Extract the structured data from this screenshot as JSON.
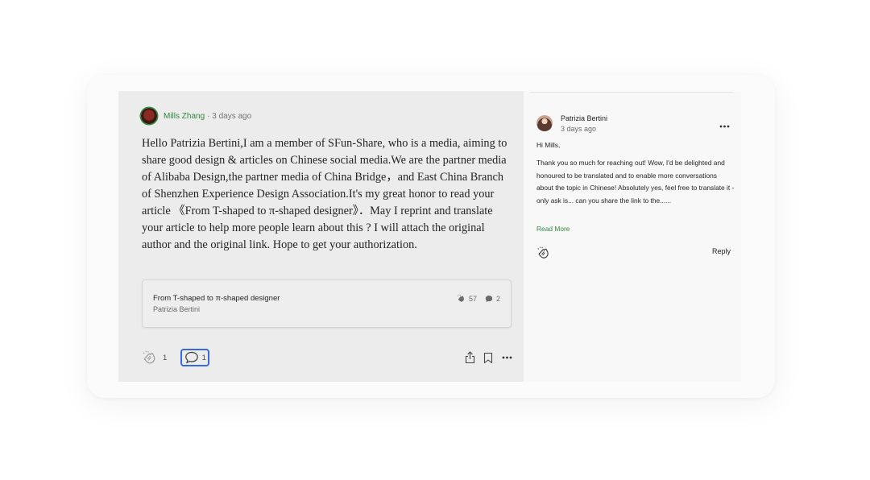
{
  "comment": {
    "author": "Mills Zhang",
    "meta": "· 3 days ago",
    "text": "Hello Patrizia Bertini,I am a member of SFun-Share, who is a media, aiming to share good design & articles on Chinese social media.We are the partner media of Alibaba Design,the partner media of China Bridge，and East China Branch of Shenzhen Experience Design Association.It's my great honor to read your article 《From T-shaped to π-shaped designer》．May I reprint and translate your article to help more people learn about this ? I will attach the original author and the original link. Hope to get your authorization.",
    "clap_count": "1",
    "response_count": "1",
    "icons": {
      "clap": "clap-icon",
      "response": "speech-bubble-icon",
      "share": "share-icon",
      "bookmark": "bookmark-icon",
      "more": "more-icon"
    }
  },
  "article": {
    "title": "From T-shaped to π-shaped designer",
    "author": "Patrizia Bertini",
    "claps": "57",
    "responses": "2"
  },
  "reply": {
    "author": "Patrizia Bertini",
    "date": "3 days ago",
    "greeting": "Hi Mills,",
    "body": "Thank you so much for reaching out! Wow, I'd be delighted and honoured to be translated and to enable more conversations about the topic in Chinese! Absolutely yes, feel free to translate it - only ask is... can you share the link to the......",
    "read_more": "Read More",
    "reply_label": "Reply"
  },
  "colors": {
    "accent_green": "#2e8a3b",
    "focus_blue": "#3a6ad9",
    "panel_grey": "#ececec"
  }
}
